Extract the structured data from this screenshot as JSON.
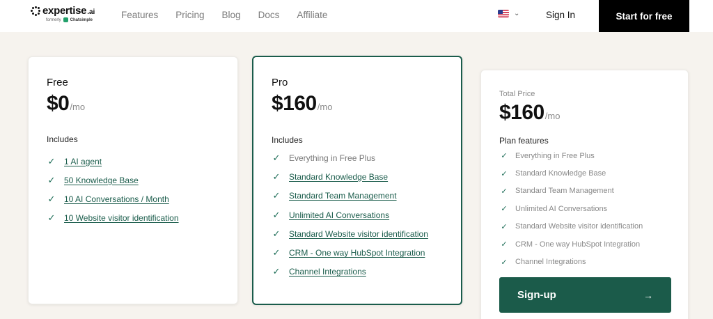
{
  "brand": {
    "name": "expertise",
    "tld": ".ai",
    "formerly": "formerly",
    "former_name": "Chatsimple"
  },
  "nav": {
    "links": [
      "Features",
      "Pricing",
      "Blog",
      "Docs",
      "Affiliate"
    ],
    "signin": "Sign In",
    "cta": "Start for free"
  },
  "plans": {
    "free": {
      "name": "Free",
      "price": "$0",
      "period": "/mo",
      "includes_label": "Includes",
      "features": [
        "1 AI agent",
        "50 Knowledge Base",
        "10 AI Conversations / Month",
        "10 Website visitor identification"
      ]
    },
    "pro": {
      "name": "Pro",
      "price": "$160",
      "period": "/mo",
      "includes_label": "Includes",
      "features": [
        "Everything in Free Plus",
        "Standard Knowledge Base",
        "Standard Team Management",
        "Unlimited AI Conversations",
        "Standard Website visitor identification",
        "CRM - One way HubSpot Integration",
        "Channel Integrations"
      ]
    }
  },
  "total": {
    "label": "Total Price",
    "price": "$160",
    "period": "/mo",
    "features_label": "Plan features",
    "features": [
      "Everything in Free Plus",
      "Standard Knowledge Base",
      "Standard Team Management",
      "Unlimited AI Conversations",
      "Standard Website visitor identification",
      "CRM - One way HubSpot Integration",
      "Channel Integrations"
    ],
    "button": "Sign-up"
  },
  "colors": {
    "accent": "#1b5b4a",
    "background": "#f6f3ee",
    "cta_bg": "#000000"
  }
}
